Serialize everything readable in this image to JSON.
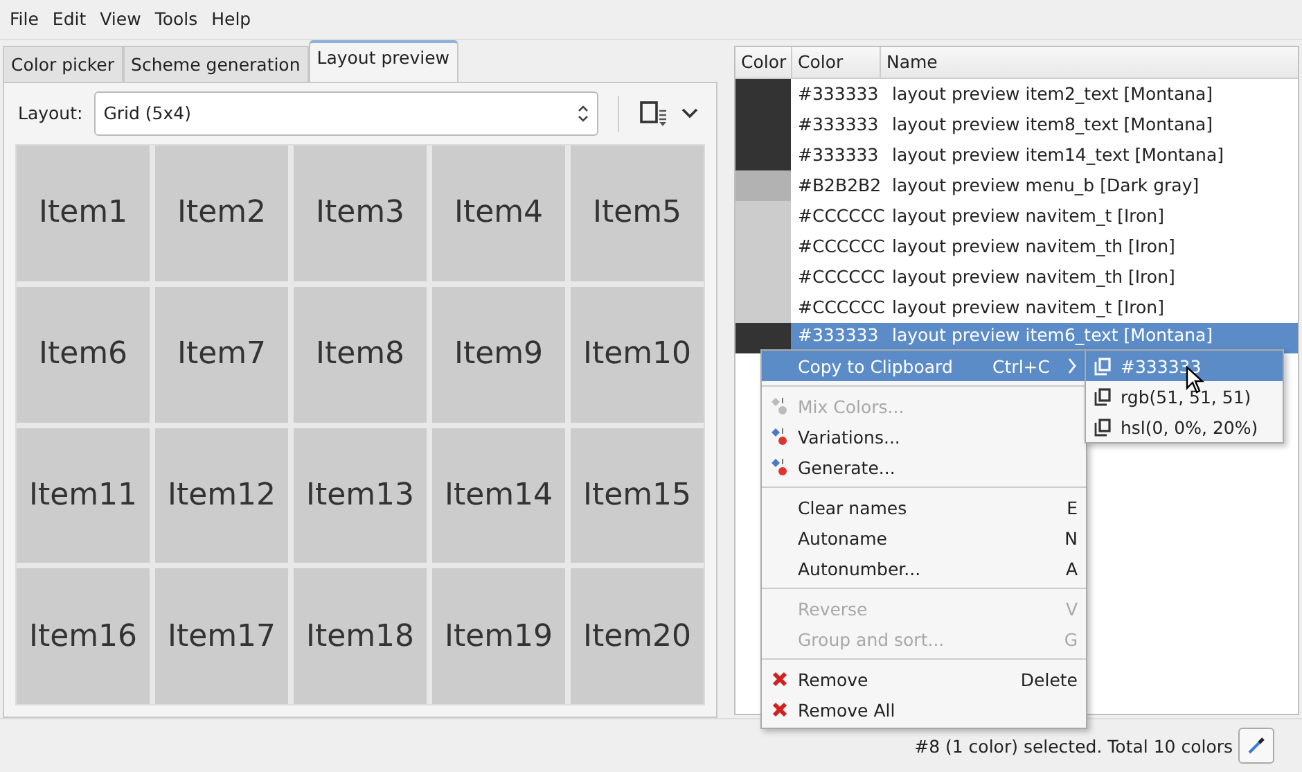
{
  "menu_bar": [
    "File",
    "Edit",
    "View",
    "Tools",
    "Help"
  ],
  "tabs": [
    {
      "label": "Color picker",
      "selected": false
    },
    {
      "label": "Scheme generation",
      "selected": false
    },
    {
      "label": "Layout preview",
      "selected": true
    }
  ],
  "layout": {
    "label": "Layout:",
    "value": "Grid (5x4)"
  },
  "preview_items": [
    "Item1",
    "Item2",
    "Item3",
    "Item4",
    "Item5",
    "Item6",
    "Item7",
    "Item8",
    "Item9",
    "Item10",
    "Item11",
    "Item12",
    "Item13",
    "Item14",
    "Item15",
    "Item16",
    "Item17",
    "Item18",
    "Item19",
    "Item20"
  ],
  "color_list": {
    "columns": [
      "Color",
      "Color",
      "Name"
    ],
    "rows": [
      {
        "color": "#333333",
        "hex": "#333333",
        "name": "layout preview item2_text [Montana]",
        "selected": false
      },
      {
        "color": "#333333",
        "hex": "#333333",
        "name": "layout preview item8_text [Montana]",
        "selected": false
      },
      {
        "color": "#333333",
        "hex": "#333333",
        "name": "layout preview item14_text [Montana]",
        "selected": false
      },
      {
        "color": "#b2b2b2",
        "hex": "#B2B2B2",
        "name": "layout preview menu_b [Dark gray]",
        "selected": false
      },
      {
        "color": "#cccccc",
        "hex": "#CCCCCC",
        "name": "layout preview navitem_t [Iron]",
        "selected": false
      },
      {
        "color": "#cccccc",
        "hex": "#CCCCCC",
        "name": "layout preview navitem_th [Iron]",
        "selected": false
      },
      {
        "color": "#cccccc",
        "hex": "#CCCCCC",
        "name": "layout preview navitem_th [Iron]",
        "selected": false
      },
      {
        "color": "#cccccc",
        "hex": "#CCCCCC",
        "name": "layout preview navitem_t [Iron]",
        "selected": false
      },
      {
        "color": "#333333",
        "hex": "#333333",
        "name": "layout preview item6_text [Montana]",
        "selected": true
      }
    ]
  },
  "context_menu": {
    "items": [
      {
        "kind": "submenu",
        "label": "Copy to Clipboard",
        "shortcut": "Ctrl+C",
        "selected": true,
        "disabled": false
      },
      {
        "kind": "separator"
      },
      {
        "kind": "mix",
        "label": "Mix Colors...",
        "selected": false,
        "disabled": true
      },
      {
        "kind": "mix",
        "label": "Variations...",
        "selected": false,
        "disabled": false
      },
      {
        "kind": "mix",
        "label": "Generate...",
        "selected": false,
        "disabled": false
      },
      {
        "kind": "separator"
      },
      {
        "kind": "item",
        "label": "Clear names",
        "shortcut": "E",
        "selected": false,
        "disabled": false
      },
      {
        "kind": "item",
        "label": "Autoname",
        "shortcut": "N",
        "selected": false,
        "disabled": false
      },
      {
        "kind": "item",
        "label": "Autonumber...",
        "shortcut": "A",
        "selected": false,
        "disabled": false
      },
      {
        "kind": "separator"
      },
      {
        "kind": "item",
        "label": "Reverse",
        "shortcut": "V",
        "selected": false,
        "disabled": true
      },
      {
        "kind": "item",
        "label": "Group and sort...",
        "shortcut": "G",
        "selected": false,
        "disabled": true
      },
      {
        "kind": "separator"
      },
      {
        "kind": "remove",
        "label": "Remove",
        "shortcut": "Delete",
        "selected": false,
        "disabled": false
      },
      {
        "kind": "remove",
        "label": "Remove All",
        "selected": false,
        "disabled": false
      }
    ]
  },
  "submenu": {
    "items": [
      {
        "label": "#333333",
        "selected": true
      },
      {
        "label": "rgb(51, 51, 51)",
        "selected": false
      },
      {
        "label": "hsl(0, 0%, 20%)",
        "selected": false
      }
    ]
  },
  "status_bar": {
    "text": "#8 (1 color) selected. Total 10 colors"
  }
}
